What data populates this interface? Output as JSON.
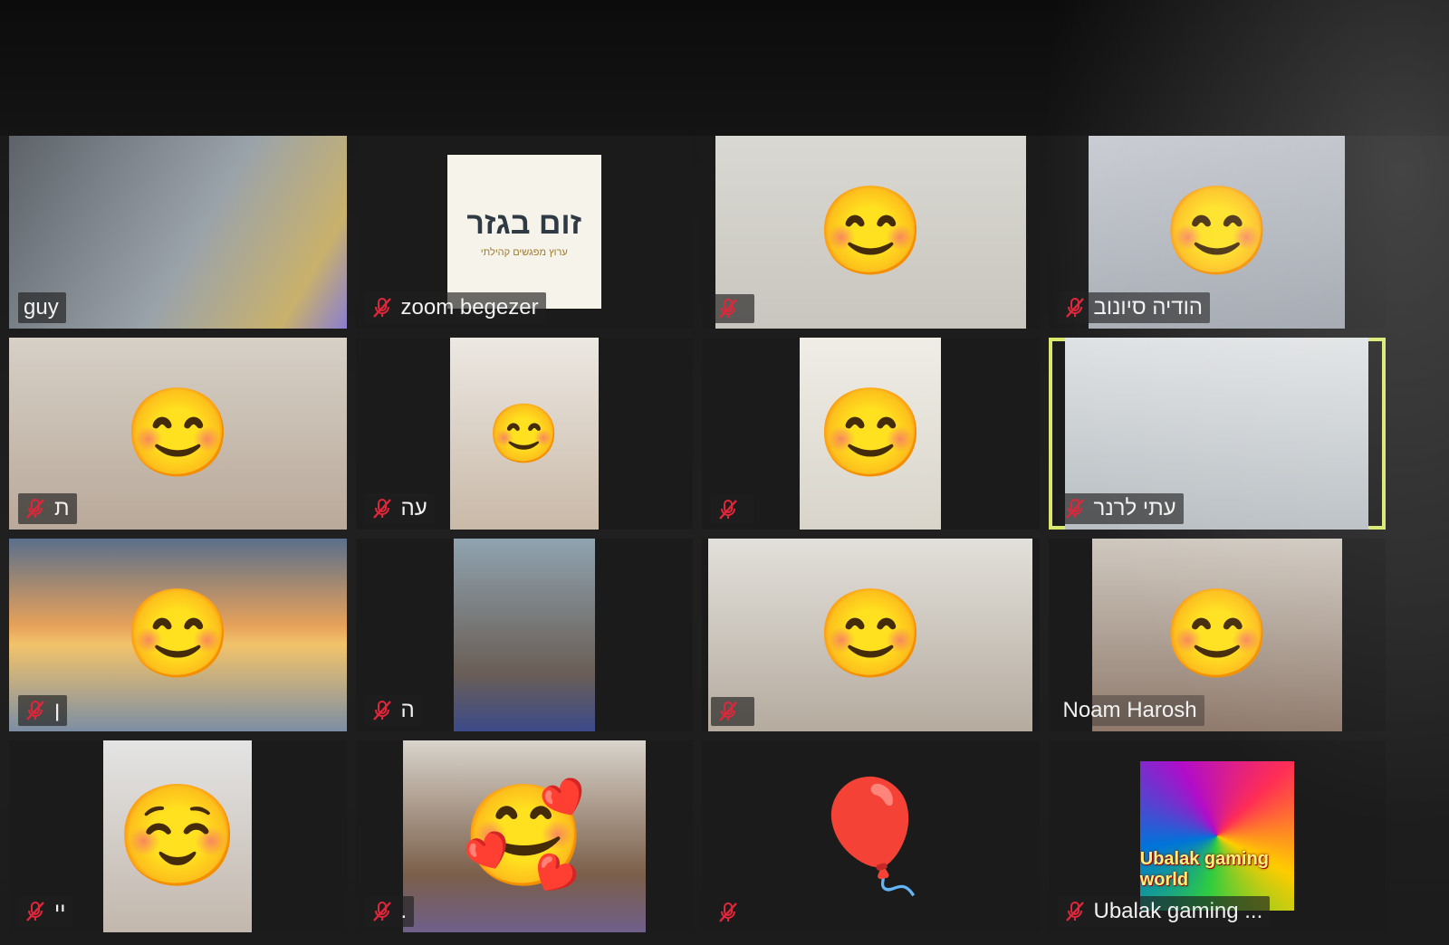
{
  "meeting": {
    "participants": [
      {
        "name": "guy",
        "muted": false,
        "bg": "#8a8f95",
        "emoji": "",
        "active": false
      },
      {
        "name": "zoom begezer",
        "muted": true,
        "bg": "#2a2a2a",
        "emoji": "",
        "active": false,
        "logo_title": "זום בגזר",
        "logo_sub": "ערוץ מפגשים קהילתי"
      },
      {
        "name": "",
        "muted": true,
        "bg": "#cfcfc8",
        "emoji": "😊",
        "active": false
      },
      {
        "name": "הודיה סיונוב",
        "muted": true,
        "bg": "#b9bcc4",
        "emoji": "😊",
        "active": false
      },
      {
        "name": "ת",
        "muted": true,
        "bg": "#c7c0b6",
        "emoji": "😊",
        "active": false
      },
      {
        "name": "עה",
        "muted": true,
        "bg": "#d8d2c8",
        "emoji": "😊",
        "active": false
      },
      {
        "name": "",
        "muted": true,
        "bg": "#e4e2da",
        "emoji": "😊",
        "active": false
      },
      {
        "name": "עתי לרנר",
        "muted": true,
        "bg": "#cfd3d6",
        "emoji": "",
        "active": true
      },
      {
        "name": "ן",
        "muted": true,
        "bg": "#d79a5a",
        "emoji": "😊",
        "active": false
      },
      {
        "name": "ה",
        "muted": true,
        "bg": "#9aa2a8",
        "emoji": "",
        "active": false
      },
      {
        "name": "",
        "muted": true,
        "bg": "#c9c4bb",
        "emoji": "😊",
        "active": false
      },
      {
        "name": "Noam Harosh",
        "muted": false,
        "bg": "#a89588",
        "emoji": "😊",
        "active": false
      },
      {
        "name": "יי",
        "muted": true,
        "bg": "#c8c8c8",
        "emoji": "☺️",
        "active": false
      },
      {
        "name": ".",
        "muted": true,
        "bg": "#b9b3ab",
        "emoji": "🥰",
        "active": false
      },
      {
        "name": "",
        "muted": true,
        "bg": "#1b1b1b",
        "emoji": "🎈",
        "active": false
      },
      {
        "name": "Ubalak gaming ...",
        "muted": true,
        "bg": "#1b1b1b",
        "emoji": "",
        "active": false,
        "card_text": "Ubalak gaming world"
      }
    ]
  },
  "colors": {
    "active_border": "#d9e86a",
    "mute_red": "#e0263a",
    "tile_bg": "#1b1b1b"
  }
}
